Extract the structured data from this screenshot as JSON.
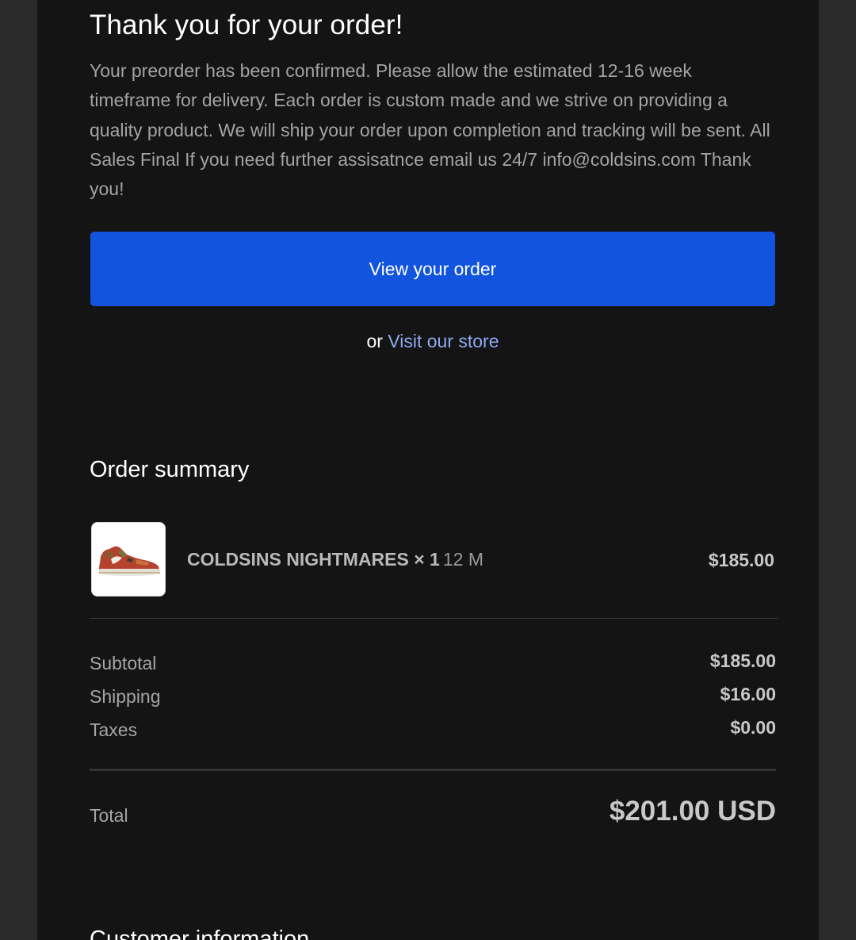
{
  "header": {
    "title": "Thank you for your order!",
    "message": "Your preorder has been confirmed. Please allow the estimated 12-16 week timeframe for delivery. Each order is custom made and we strive on providing a quality product. We will ship your order upon completion and tracking will be sent. All Sales Final If you need further assisatnce email us 24/7 info@coldsins.com Thank you!"
  },
  "actions": {
    "view_order_label": "View your order",
    "or_text": "or",
    "visit_store_label": "Visit our store"
  },
  "order_summary": {
    "heading": "Order summary",
    "items": [
      {
        "name": "COLDSINS NIGHTMARES × 1",
        "variant": "12 M",
        "price": "$185.00",
        "thumbnail": "sneaker-image"
      }
    ],
    "subtotal_label": "Subtotal",
    "subtotal_value": "$185.00",
    "shipping_label": "Shipping",
    "shipping_value": "$16.00",
    "taxes_label": "Taxes",
    "taxes_value": "$0.00",
    "total_label": "Total",
    "total_value": "$201.00 USD"
  },
  "customer_information": {
    "heading": "Customer information"
  },
  "colors": {
    "page_bg": "#2a2a2a",
    "card_bg": "#141414",
    "button_blue": "#1254de",
    "link_blue": "#8ea9f1"
  }
}
